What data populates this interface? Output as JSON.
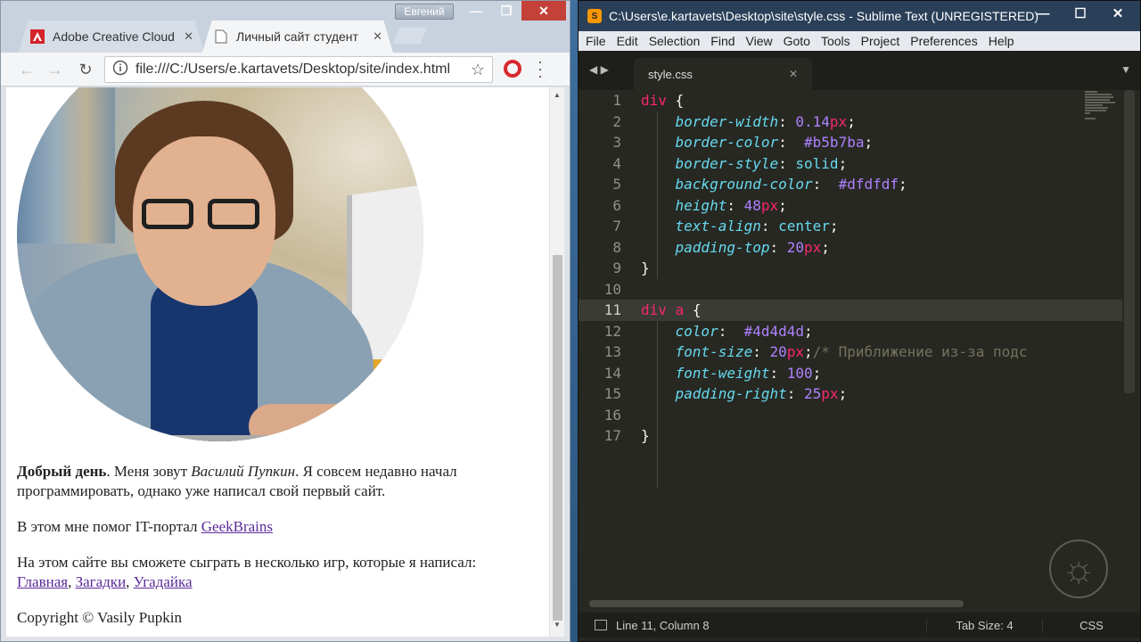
{
  "chrome": {
    "profile_name": "Евгений",
    "tabs": [
      {
        "label": "Adobe Creative Cloud",
        "icon": "adobe-icon"
      },
      {
        "label": "Личный сайт студент",
        "icon": "page-icon"
      }
    ],
    "url": "file:///C:/Users/e.kartavets/Desktop/site/index.html",
    "page": {
      "p1_bold": "Добрый день",
      "p1_a": ". Меня зовут ",
      "p1_italic": "Василий Пупкин",
      "p1_b": ". Я совсем недавно начал программировать, однако уже написал свой первый сайт.",
      "p2_text": "В этом мне помог IT-портал ",
      "p2_link": "GeekBrains",
      "p3_text": "На этом сайте вы сможете сыграть в несколько игр, которые я написал:",
      "links": [
        "Главная",
        "Загадки",
        "Угадайка"
      ],
      "copyright": "Copyright © Vasily Pupkin"
    }
  },
  "sublime": {
    "title": "C:\\Users\\e.kartavets\\Desktop\\site\\style.css - Sublime Text (UNREGISTERED)",
    "menu": [
      "File",
      "Edit",
      "Selection",
      "Find",
      "View",
      "Goto",
      "Tools",
      "Project",
      "Preferences",
      "Help"
    ],
    "tab_label": "style.css",
    "line_numbers": [
      "1",
      "2",
      "3",
      "4",
      "5",
      "6",
      "7",
      "8",
      "9",
      "10",
      "11",
      "12",
      "13",
      "14",
      "15",
      "16",
      "17"
    ],
    "code": {
      "l1_sel": "div",
      "l1_brace": " {",
      "l2_prop": "border-width",
      "l2_num": "0.14",
      "l2_unit": "px",
      "l3_prop": "border-color",
      "l3_val": "#b5b7ba",
      "l4_prop": "border-style",
      "l4_val": "solid",
      "l5_prop": "background-color",
      "l5_val": "#dfdfdf",
      "l6_prop": "height",
      "l6_num": "48",
      "l6_unit": "px",
      "l7_prop": "text-align",
      "l7_val": "center",
      "l8_prop": "padding-top",
      "l8_num": "20",
      "l8_unit": "px",
      "close": "}",
      "l11_sel1": "div",
      "l11_sel2": "a",
      "l12_prop": "color",
      "l12_val": "#4d4d4d",
      "l13_prop": "font-size",
      "l13_num": "20",
      "l13_unit": "px",
      "l13_comment": "/* Приближение из-за подс",
      "l14_prop": "font-weight",
      "l14_num": "100",
      "l15_prop": "padding-right",
      "l15_num": "25",
      "l15_unit": "px"
    },
    "status": {
      "position": "Line 11, Column 8",
      "tab_size": "Tab Size: 4",
      "syntax": "CSS"
    }
  }
}
